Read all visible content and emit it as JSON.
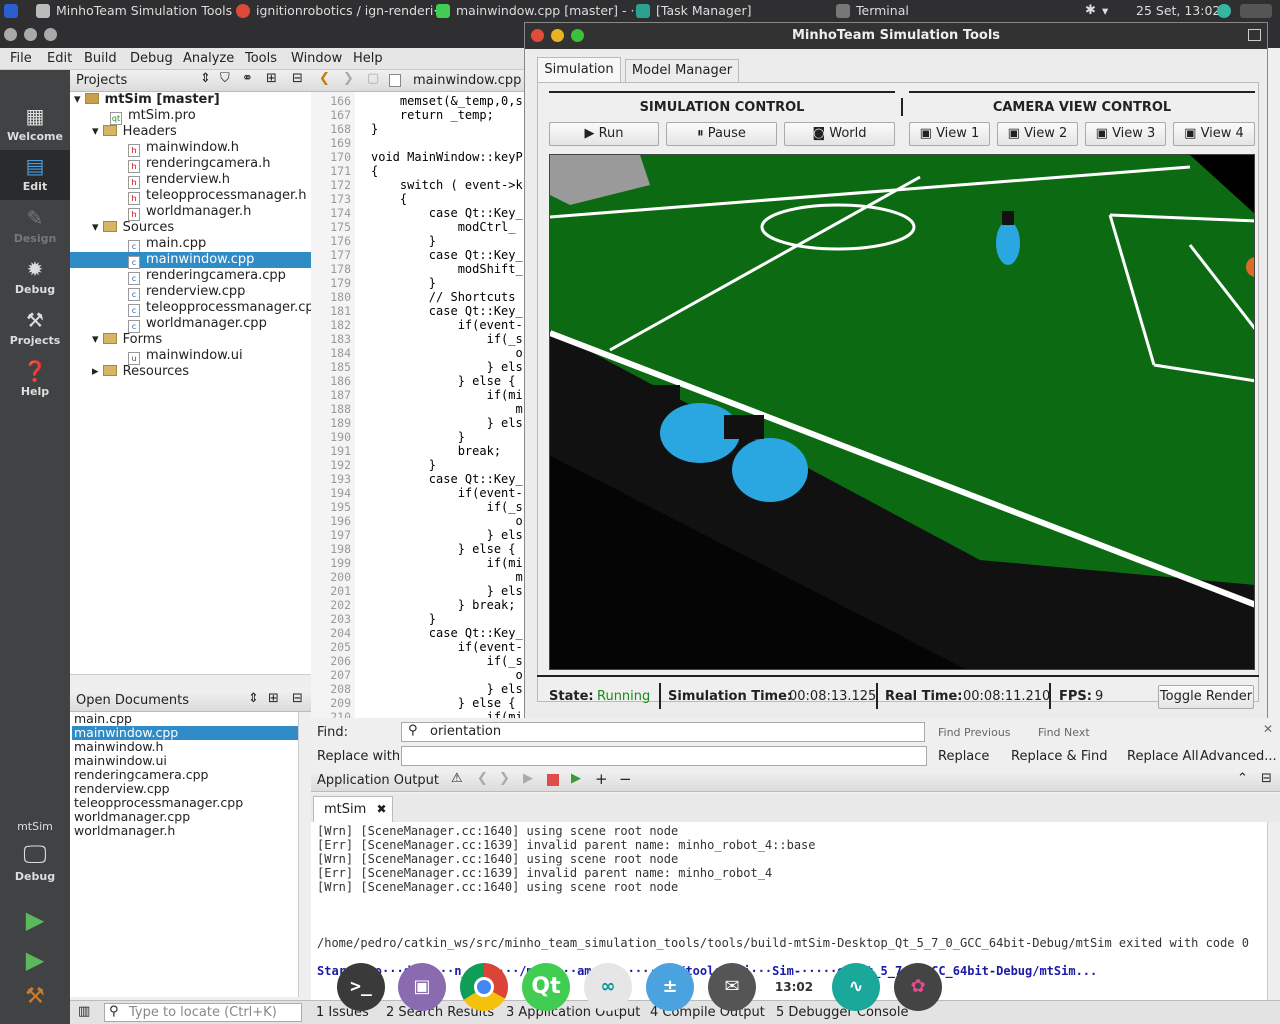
{
  "topbar": {
    "items": [
      {
        "label": "MinhoTeam Simulation Tools"
      },
      {
        "label": "ignitionrobotics / ign-renderi··"
      },
      {
        "label": "mainwindow.cpp [master] - ···"
      },
      {
        "label": "[Task Manager]"
      },
      {
        "label": "Terminal"
      }
    ],
    "clock": "25 Set, 13:02"
  },
  "menubar": [
    "File",
    "Edit",
    "Build",
    "Debug",
    "Analyze",
    "Tools",
    "Window",
    "Help"
  ],
  "modes": [
    "Welcome",
    "Edit",
    "Design",
    "Debug",
    "Projects",
    "Help"
  ],
  "kit": {
    "project": "mtSim",
    "mode": "Debug"
  },
  "projects": {
    "header": "Projects",
    "tree": [
      {
        "label": "mtSim [master]",
        "kind": "project"
      },
      {
        "label": "mtSim.pro",
        "kind": "pro"
      },
      {
        "label": "Headers",
        "kind": "folder"
      },
      {
        "label": "mainwindow.h",
        "kind": "h"
      },
      {
        "label": "renderingcamera.h",
        "kind": "h"
      },
      {
        "label": "renderview.h",
        "kind": "h"
      },
      {
        "label": "teleopprocessmanager.h",
        "kind": "h"
      },
      {
        "label": "worldmanager.h",
        "kind": "h"
      },
      {
        "label": "Sources",
        "kind": "folder"
      },
      {
        "label": "main.cpp",
        "kind": "cpp"
      },
      {
        "label": "mainwindow.cpp",
        "kind": "cpp"
      },
      {
        "label": "renderingcamera.cpp",
        "kind": "cpp"
      },
      {
        "label": "renderview.cpp",
        "kind": "cpp"
      },
      {
        "label": "teleopprocessmanager.cpp",
        "kind": "cpp"
      },
      {
        "label": "worldmanager.cpp",
        "kind": "cpp"
      },
      {
        "label": "Forms",
        "kind": "folder"
      },
      {
        "label": "mainwindow.ui",
        "kind": "ui"
      },
      {
        "label": "Resources",
        "kind": "folder"
      }
    ]
  },
  "open_documents": {
    "header": "Open Documents",
    "items": [
      "main.cpp",
      "mainwindow.cpp",
      "mainwindow.h",
      "mainwindow.ui",
      "renderingcamera.cpp",
      "renderview.cpp",
      "teleopprocessmanager.cpp",
      "worldmanager.cpp",
      "worldmanager.h"
    ]
  },
  "editor": {
    "tab": "mainwindow.cpp",
    "lines": [
      {
        "n": "166",
        "code": "    memset(&_temp,0,s"
      },
      {
        "n": "167",
        "code": "    return _temp;"
      },
      {
        "n": "168",
        "code": "}"
      },
      {
        "n": "169",
        "code": ""
      },
      {
        "n": "170",
        "code": "void MainWindow::keyP"
      },
      {
        "n": "171",
        "code": "{"
      },
      {
        "n": "172",
        "code": "    switch ( event->k"
      },
      {
        "n": "173",
        "code": "    {"
      },
      {
        "n": "174",
        "code": "        case Qt::Key_"
      },
      {
        "n": "175",
        "code": "            modCtrl_"
      },
      {
        "n": "176",
        "code": "        }"
      },
      {
        "n": "177",
        "code": "        case Qt::Key_"
      },
      {
        "n": "178",
        "code": "            modShift_"
      },
      {
        "n": "179",
        "code": "        }"
      },
      {
        "n": "180",
        "code": "        // Shortcuts"
      },
      {
        "n": "181",
        "code": "        case Qt::Key_"
      },
      {
        "n": "182",
        "code": "            if(event-"
      },
      {
        "n": "183",
        "code": "                if(_s"
      },
      {
        "n": "184",
        "code": "                    o"
      },
      {
        "n": "185",
        "code": "                } els"
      },
      {
        "n": "186",
        "code": "            } else {"
      },
      {
        "n": "187",
        "code": "                if(mi"
      },
      {
        "n": "188",
        "code": "                    m"
      },
      {
        "n": "189",
        "code": "                } els"
      },
      {
        "n": "190",
        "code": "            }"
      },
      {
        "n": "191",
        "code": "            break;"
      },
      {
        "n": "192",
        "code": "        }"
      },
      {
        "n": "193",
        "code": "        case Qt::Key_"
      },
      {
        "n": "194",
        "code": "            if(event-"
      },
      {
        "n": "195",
        "code": "                if(_s"
      },
      {
        "n": "196",
        "code": "                    o"
      },
      {
        "n": "197",
        "code": "                } els"
      },
      {
        "n": "198",
        "code": "            } else {"
      },
      {
        "n": "199",
        "code": "                if(mi"
      },
      {
        "n": "200",
        "code": "                    m"
      },
      {
        "n": "201",
        "code": "                } els"
      },
      {
        "n": "202",
        "code": "            } break;"
      },
      {
        "n": "203",
        "code": "        }"
      },
      {
        "n": "204",
        "code": "        case Qt::Key_"
      },
      {
        "n": "205",
        "code": "            if(event-"
      },
      {
        "n": "206",
        "code": "                if(_s"
      },
      {
        "n": "207",
        "code": "                    o"
      },
      {
        "n": "208",
        "code": "                } els"
      },
      {
        "n": "209",
        "code": "            } else {"
      },
      {
        "n": "210",
        "code": "                if(mi"
      }
    ]
  },
  "find": {
    "find_label": "Find:",
    "find_value": "orientation",
    "replace_label": "Replace with:",
    "find_previous": "Find Previous",
    "find_next": "Find Next",
    "replace": "Replace",
    "replace_find": "Replace & Find",
    "replace_all": "Replace All",
    "advanced": "Advanced..."
  },
  "output": {
    "header": "Application Output",
    "tab": "mtSim",
    "lines": [
      "[Wrn] [SceneManager.cc:1640] using scene root node",
      "[Err] [SceneManager.cc:1639] invalid parent name: minho_robot_4::base",
      "[Wrn] [SceneManager.cc:1640] using scene root node",
      "[Err] [SceneManager.cc:1639] invalid parent name: minho_robot_4",
      "[Wrn] [SceneManager.cc:1640] using scene root node"
    ],
    "exit_line": "/home/pedro/catkin_ws/src/minho_team_simulation_tools/tools/build-mtSim-Desktop_Qt_5_7_0_GCC_64bit-Debug/mtSim exited with code 0",
    "start_line": "Star··/ho···dro/···n_w······/mi·····am_s········ls/tools/bui···Sim-·····op_Qt_5_7_0_GCC_64bit-Debug/mtSim..."
  },
  "status": {
    "locate_placeholder": "Type to locate (Ctrl+K)",
    "panes": [
      "1 Issues",
      "2 Search Results",
      "3 Application Output",
      "4 Compile Output",
      "5 Debugger Console"
    ]
  },
  "sim": {
    "title": "MinhoTeam Simulation Tools",
    "tabs": [
      "Simulation",
      "Model Manager"
    ],
    "sim_control_title": "SIMULATION CONTROL",
    "camera_control_title": "CAMERA VIEW CONTROL",
    "sim_buttons": [
      "Run",
      "Pause",
      "World"
    ],
    "camera_buttons": [
      "View 1",
      "View 2",
      "View 3",
      "View 4"
    ],
    "state_label": "State:",
    "state_value": "Running",
    "sim_time_label": "Simulation Time:",
    "sim_time_value": "00:08:13.125",
    "real_time_label": "Real Time:",
    "real_time_value": "00:08:11.210",
    "fps_label": "FPS:",
    "fps_value": "9",
    "toggle_render": "Toggle Render"
  },
  "dock": {
    "clock": "13:02"
  },
  "colors": {
    "selection": "#308cc6",
    "field": "#0c6b12",
    "robot": "#2aa6e0",
    "running": "#1a8a1a"
  }
}
